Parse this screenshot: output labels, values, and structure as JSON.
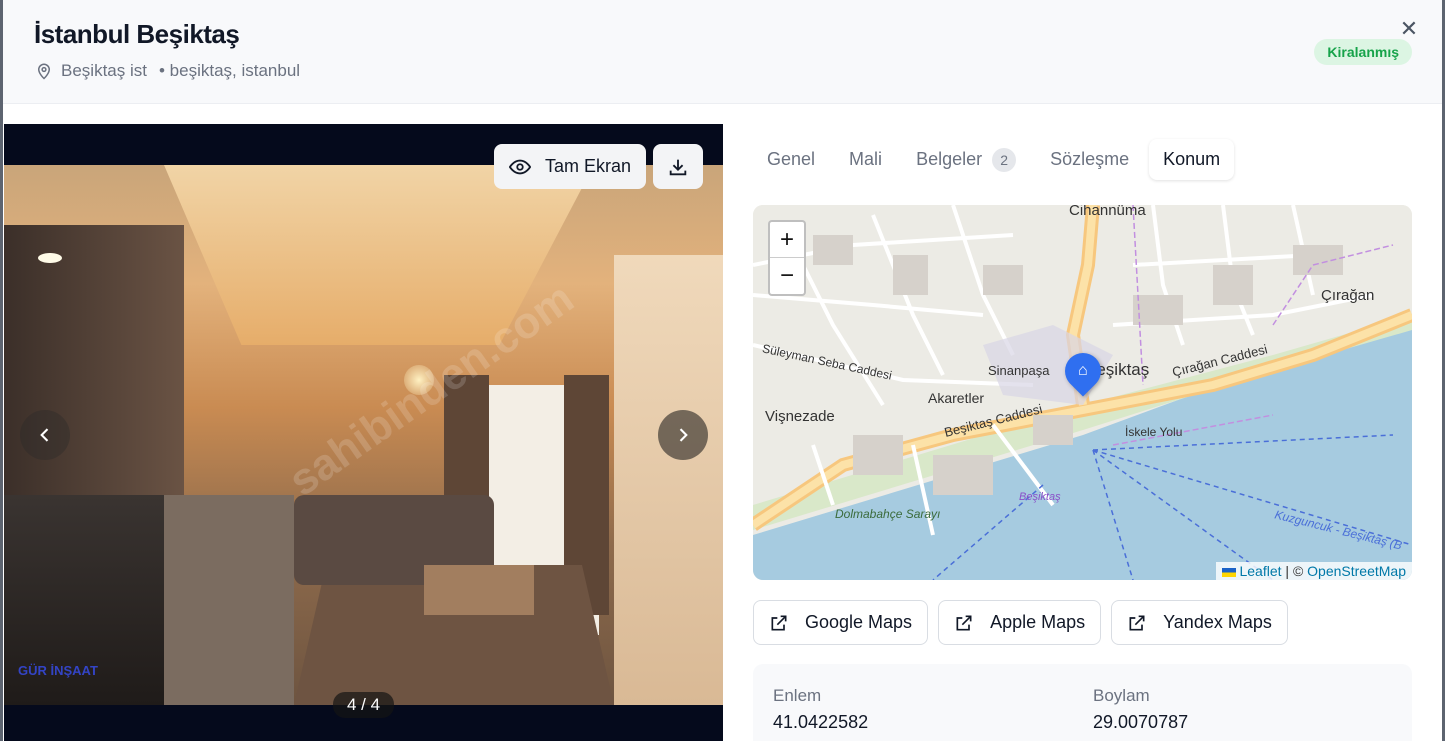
{
  "header": {
    "title": "İstanbul Beşiktaş",
    "location_name": "Beşiktaş ist",
    "location_detail": "• beşiktaş, istanbul",
    "status_badge": "Kiralanmış",
    "close_icon": "close-icon"
  },
  "gallery": {
    "fullscreen_label": "Tam Ekran",
    "counter": "4 / 4",
    "watermark": "sahibinden.com",
    "logo_text": "GÜR İNŞAAT"
  },
  "tabs": [
    {
      "label": "Genel"
    },
    {
      "label": "Mali"
    },
    {
      "label": "Belgeler",
      "count": "2"
    },
    {
      "label": "Sözleşme"
    },
    {
      "label": "Konum",
      "active": true
    }
  ],
  "map": {
    "zoom_in": "+",
    "zoom_out": "−",
    "attribution_leaflet": "Leaflet",
    "attribution_sep": "| ©",
    "attribution_osm": "OpenStreetMap",
    "labels": {
      "cihannuma": "Cihannüma",
      "ciragan": "Çırağan",
      "ciragan_caddesi": "Çırağan Caddesi",
      "sinanpasa": "Sinanpaşa",
      "besiktas": "Beşiktaş",
      "akaretler": "Akaretler",
      "visnezade": "Vişnezade",
      "besiktas_caddesi": "Beşiktaş Caddesi",
      "suleyman": "Süleyman Seba Caddesi",
      "dolmabahce": "Dolmabahçe Sarayı",
      "iskele": "İskele Yolu",
      "ferry": "Kuzguncuk - Beşiktaş (B",
      "besiktas_pier": "Beşiktaş"
    }
  },
  "map_links": [
    {
      "label": "Google Maps"
    },
    {
      "label": "Apple Maps"
    },
    {
      "label": "Yandex Maps"
    }
  ],
  "coordinates": {
    "lat_label": "Enlem",
    "lat_value": "41.0422582",
    "lng_label": "Boylam",
    "lng_value": "29.0070787"
  }
}
